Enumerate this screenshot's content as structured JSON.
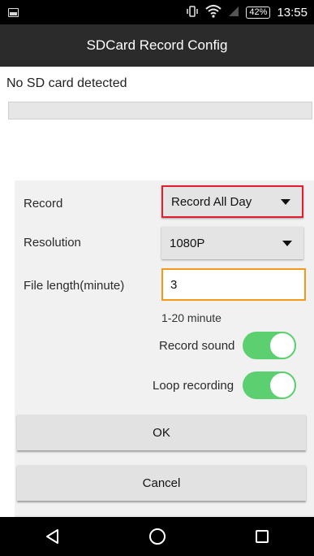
{
  "status_bar": {
    "gallery_icon": "image-icon",
    "vibrate_icon": "vibrate-icon",
    "wifi_icon": "wifi-icon",
    "signal_icon": "signal-icon",
    "battery": "42%",
    "time": "13:55"
  },
  "title_bar": {
    "title": "SDCard Record Config"
  },
  "sd_card": {
    "status": "No SD card detected",
    "progress_fraction": 0
  },
  "form": {
    "record": {
      "label": "Record",
      "value": "Record All Day"
    },
    "resolution": {
      "label": "Resolution",
      "value": "1080P"
    },
    "file_length": {
      "label": "File length(minute)",
      "value": "3",
      "hint": "1-20 minute"
    },
    "record_sound": {
      "label": "Record sound",
      "on": true
    },
    "loop_recording": {
      "label": "Loop recording",
      "on": true
    }
  },
  "buttons": {
    "ok": "OK",
    "cancel": "Cancel"
  },
  "nav": {
    "back_icon": "back-triangle-icon",
    "home_icon": "home-icon",
    "recents_icon": "recents-square-icon"
  },
  "colors": {
    "highlight_border": "#e21f2f",
    "input_focus_border": "#f39a1c",
    "toggle_on": "#5cd071"
  }
}
